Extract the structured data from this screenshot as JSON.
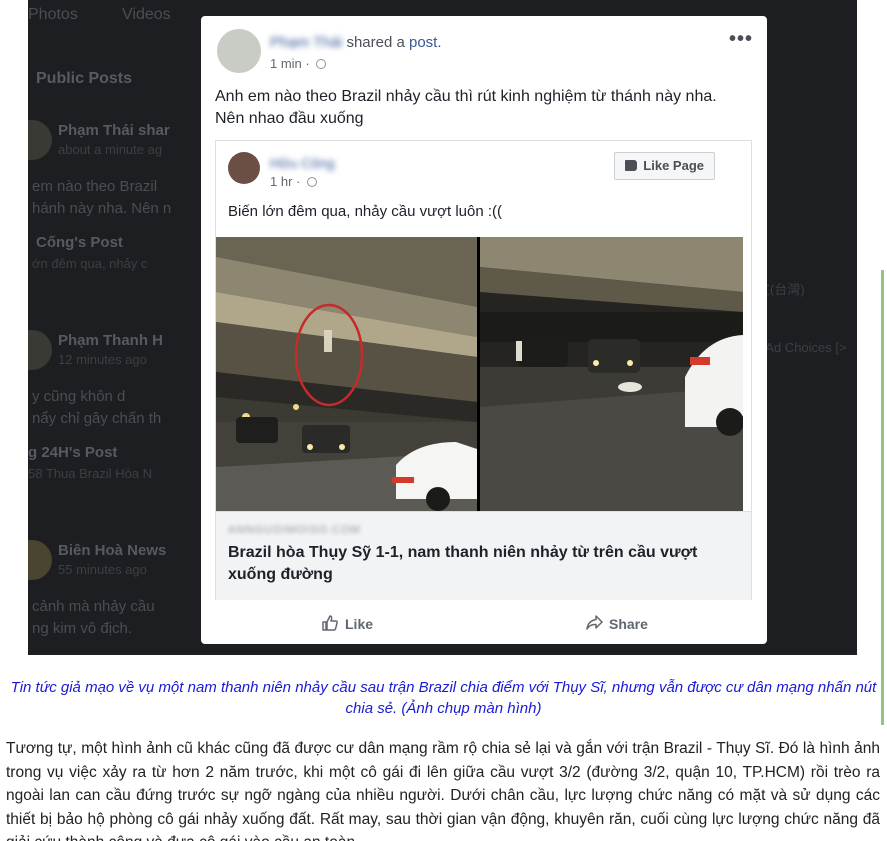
{
  "background_feed": {
    "tabs": [
      "Photos",
      "Videos"
    ],
    "section_title": "Public Posts",
    "items": [
      {
        "name": "Phạm Thái shar",
        "time": "about a minute ag"
      },
      {
        "text1": "em nào theo Brazil",
        "text2": "hánh này nha. Nên n"
      },
      {
        "shared_title": "Cống's Post",
        "shared_text": "ớn đêm qua, nhảy c"
      },
      {
        "name": "Phạm Thanh H",
        "time": "12 minutes ago"
      },
      {
        "text1": "y cũng khôn d",
        "text2": "nẩy chỉ gây chấn th"
      },
      {
        "shared_title": "g 24H's Post",
        "shared_text": "58 Thua Brazil Hòa N"
      },
      {
        "name": "Biên Hoà News",
        "time": "55 minutes ago"
      },
      {
        "text1": "cảnh mà nhảy cầu",
        "text2": "ng kim vô địch."
      }
    ],
    "right_column": {
      "language": "中文(台灣)",
      "ad_choices": "ng · Ad Choices [>"
    }
  },
  "post": {
    "author": "Phạm Thái",
    "action_text": "shared a",
    "action_link": "post.",
    "time": "1 min",
    "more_icon": "more-options-icon",
    "text_line1": "Anh em nào theo Brazil nhảy cầu thì rút kinh nghiệm từ thánh này nha.",
    "text_line2": "Nên nhao đầu xuống"
  },
  "shared_post": {
    "author": "Hữu Công",
    "time": "1 hr",
    "like_page_label": "Like Page",
    "text": "Biến lớn đêm qua, nhảy cầu vượt luôn :((",
    "link_domain": "ANNGUOIMOISO.COM",
    "link_headline": "Brazil hòa Thụy Sỹ 1-1, nam thanh niên nhảy từ trên cầu vượt xuống đường"
  },
  "actions": {
    "like_label": "Like",
    "share_label": "Share"
  },
  "article": {
    "caption": "Tin tức giả mạo về vụ một nam thanh niên nhảy cầu sau trận Brazil chia điểm với Thụy Sĩ, nhưng vẫn được cư dân mạng nhấn nút chia sẻ. (Ảnh chụp màn hình)",
    "paragraph": "Tương tự, một hình ảnh cũ khác cũng đã được cư dân mạng rầm rộ chia sẻ lại và gắn với trận Brazil - Thụy Sĩ. Đó là hình ảnh trong vụ việc xảy ra từ hơn 2 năm trước, khi một cô gái đi lên giữa cầu vượt 3/2 (đường 3/2, quận 10, TP.HCM) rồi trèo ra ngoài lan can cầu đứng trước sự ngỡ ngàng của nhiều người. Dưới chân cầu, lực lượng chức năng có mặt và sử dụng các thiết bị bảo hộ phòng cô gái nhảy xuống đất. Rất may, sau thời gian vận động, khuyên răn, cuối cùng lực lượng chức năng đã giải cứu thành công và đưa cô gái vào cầu an toàn."
  },
  "colors": {
    "link": "#385898",
    "caption": "#1a1ad6",
    "highlight_circle": "#c62a2a"
  }
}
